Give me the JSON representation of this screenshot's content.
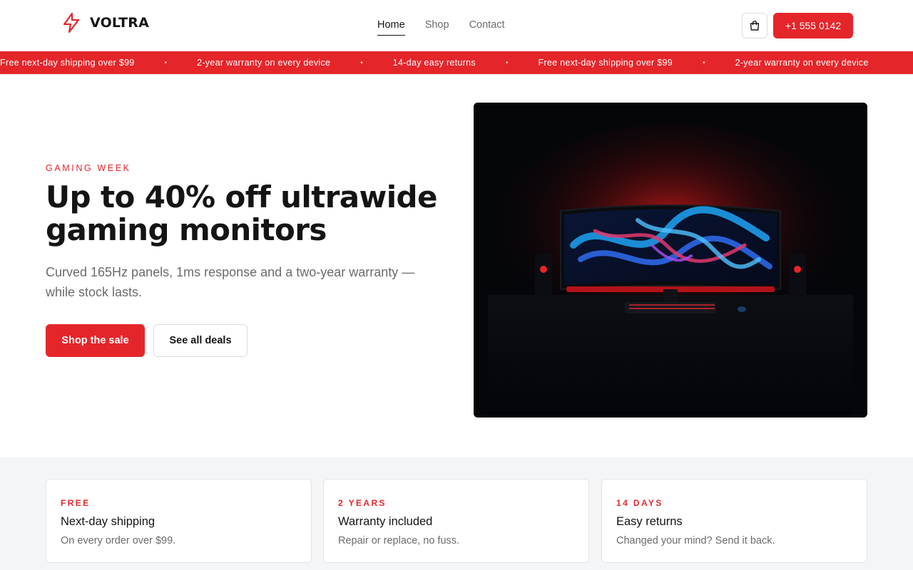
{
  "brand": {
    "name": "VOLTRA",
    "accent_color": "#e4262a",
    "logo_icon": "lightning-bolt-icon"
  },
  "nav": {
    "items": [
      {
        "label": "Home",
        "active": true
      },
      {
        "label": "Shop",
        "active": false
      },
      {
        "label": "Contact",
        "active": false
      }
    ]
  },
  "header": {
    "cart_icon": "shopping-bag-icon",
    "phone_label": "+1 555 0142"
  },
  "ticker": {
    "items": [
      "Free next-day shipping over $99",
      "2-year warranty on every device",
      "14-day easy returns",
      "Free next-day shipping over $99",
      "2-year warranty on every device"
    ],
    "separator": "•"
  },
  "hero": {
    "eyebrow": "GAMING WEEK",
    "title": "Up to 40% off ultrawide gaming monitors",
    "subtitle": "Curved 165Hz panels, 1ms response and a two-year warranty — while stock lasts.",
    "primary_cta": "Shop the sale",
    "secondary_cta": "See all deals",
    "image_label": "ultrawide-monitor-product-image"
  },
  "features": [
    {
      "eyebrow": "FREE",
      "title": "Next-day shipping",
      "text": "On every order over $99."
    },
    {
      "eyebrow": "2 YEARS",
      "title": "Warranty included",
      "text": "Repair or replace, no fuss."
    },
    {
      "eyebrow": "14 DAYS",
      "title": "Easy returns",
      "text": "Changed your mind? Send it back."
    }
  ]
}
